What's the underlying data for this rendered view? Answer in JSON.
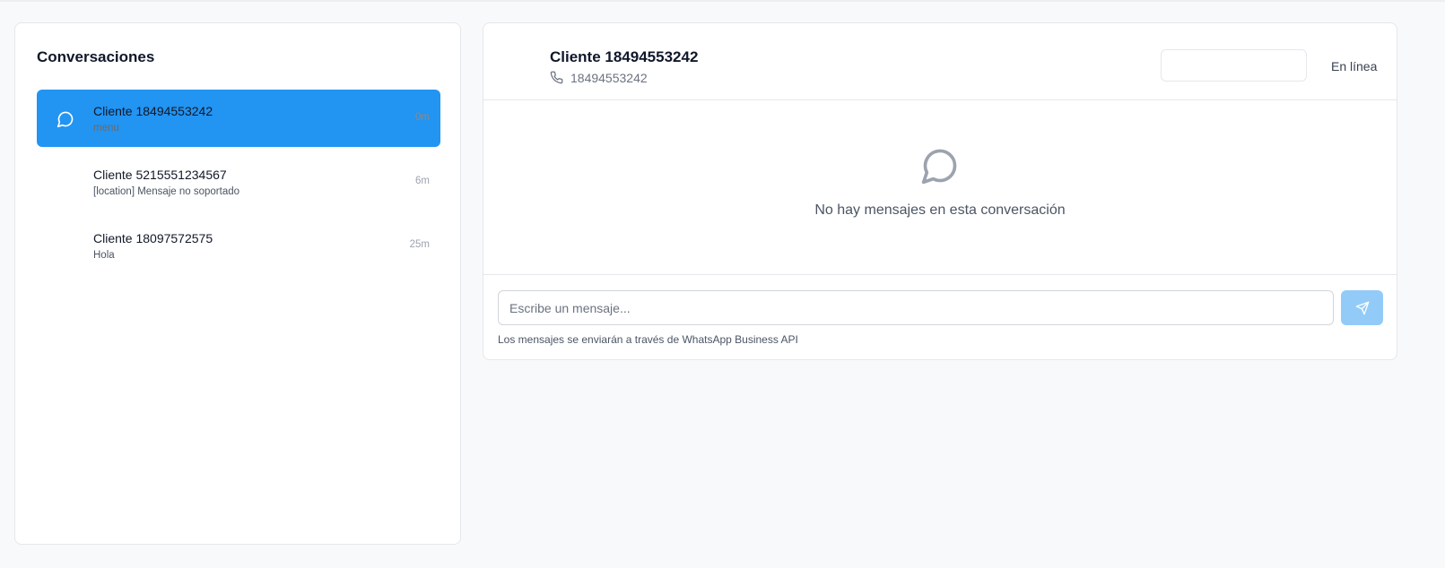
{
  "sidebar": {
    "title": "Conversaciones",
    "conversations": [
      {
        "name": "Cliente 18494553242",
        "preview": "menu",
        "time": "0m",
        "active": true
      },
      {
        "name": "Cliente 5215551234567",
        "preview": "[location] Mensaje no soportado",
        "time": "6m",
        "active": false
      },
      {
        "name": "Cliente 18097572575",
        "preview": "Hola",
        "time": "25m",
        "active": false
      }
    ]
  },
  "chat": {
    "contact_name": "Cliente 18494553242",
    "contact_phone": "18494553242",
    "status": "En línea",
    "empty_message": "No hay mensajes en esta conversación",
    "input_placeholder": "Escribe un mensaje...",
    "input_value": "",
    "footnote": "Los mensajes se enviarán a través de WhatsApp Business API"
  },
  "icons": {
    "active_conversation": "message-circle-icon",
    "phone": "phone-icon",
    "empty_state": "message-circle-icon",
    "send": "send-icon"
  },
  "colors": {
    "accent": "#2294f2",
    "send_button": "#92cbf8",
    "empty_icon": "#9ca3af"
  }
}
